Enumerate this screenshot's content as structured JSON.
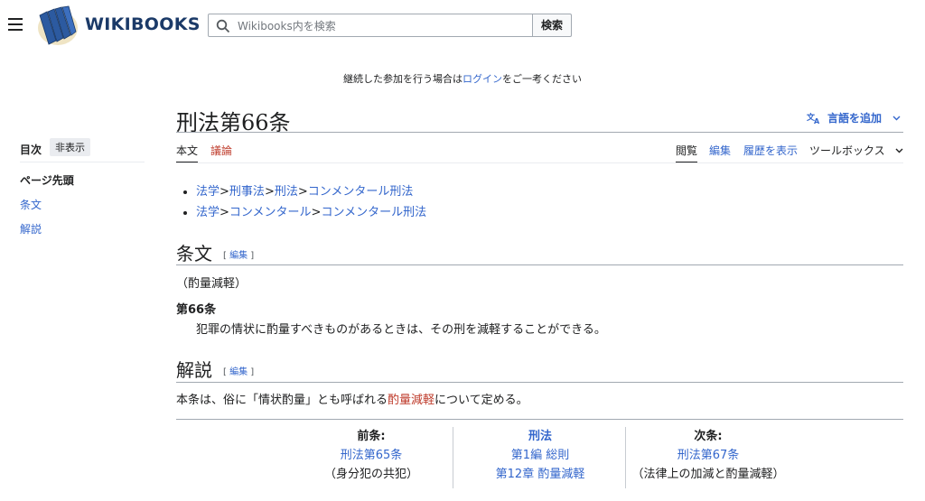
{
  "header": {
    "site_name": "WIKIBOOKS",
    "search_placeholder": "Wikibooks内を検索",
    "search_button": "検索"
  },
  "notice": {
    "before": "継続した参加を行う場合は",
    "link": "ログイン",
    "after": "をご一考ください"
  },
  "toc": {
    "title": "目次",
    "hide_button": "非表示",
    "items": [
      "ページ先頭",
      "条文",
      "解説"
    ]
  },
  "page": {
    "title": "刑法第66条",
    "language_button": "言語を追加",
    "tabs_left": [
      "本文",
      "議論"
    ],
    "tabs_right": [
      "閲覧",
      "編集",
      "履歴を表示",
      "ツールボックス"
    ]
  },
  "breadcrumbs": [
    [
      "法学",
      "刑事法",
      "刑法",
      "コンメンタール刑法"
    ],
    [
      "法学",
      "コンメンタール",
      "コンメンタール刑法"
    ]
  ],
  "breadcrumb_separator": ">",
  "sections": {
    "article": {
      "heading": "条文",
      "edit_label": "編集",
      "caption": "（酌量減軽）",
      "article_no": "第66条",
      "text": "犯罪の情状に酌量すべきものがあるときは、その刑を減軽することができる。"
    },
    "commentary": {
      "heading": "解説",
      "edit_label": "編集",
      "text_before": "本条は、俗に「情状酌量」とも呼ばれる",
      "link": "酌量減軽",
      "text_after": "について定める。"
    }
  },
  "navigation": {
    "prev_label": "前条:",
    "prev_link": "刑法第65条",
    "prev_desc": "（身分犯の共犯）",
    "center_title": "刑法",
    "center_part": "第1編 総則",
    "center_chapter": "第12章 酌量減軽",
    "next_label": "次条:",
    "next_link": "刑法第67条",
    "next_desc": "（法律上の加減と酌量減軽）"
  }
}
